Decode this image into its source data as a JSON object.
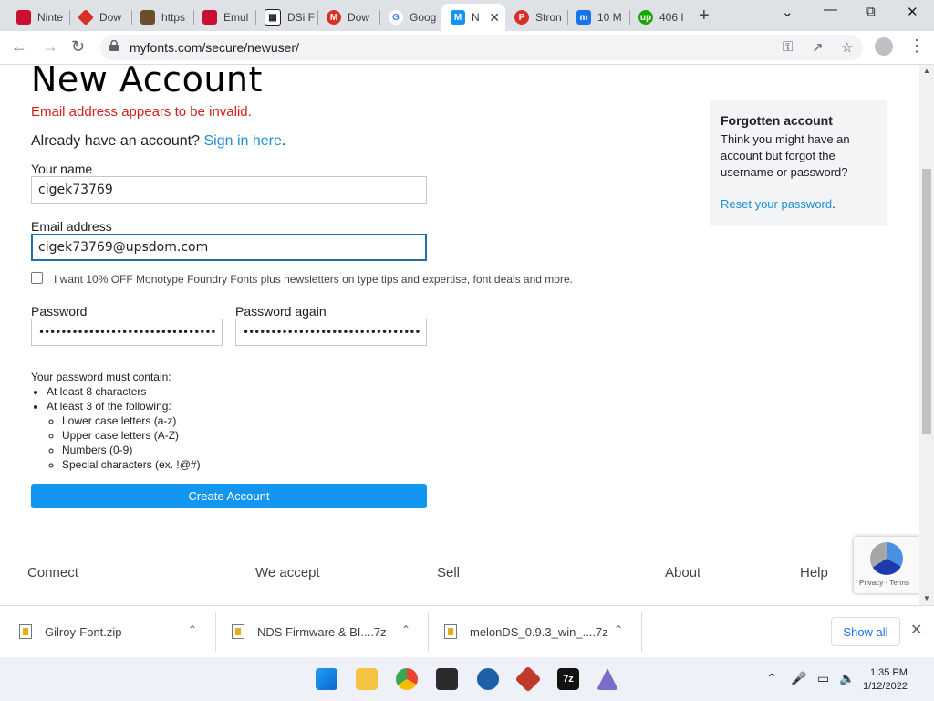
{
  "browser": {
    "tabs": [
      {
        "label": "Ninte",
        "icon": "nintendo-icon",
        "color": "#c8102e"
      },
      {
        "label": "Dow",
        "icon": "diamond-icon",
        "color": "#d93025"
      },
      {
        "label": "https",
        "icon": "cat-icon",
        "color": "#6b4f2a"
      },
      {
        "label": "Emul",
        "icon": "nintendo-icon",
        "color": "#c8102e"
      },
      {
        "label": "DSi F",
        "icon": "museum-icon",
        "color": "#202124"
      },
      {
        "label": "Dow",
        "icon": "mega-icon",
        "color": "#d93025"
      },
      {
        "label": "Goog",
        "icon": "google-icon",
        "color": "#4285f4"
      },
      {
        "label": "N",
        "icon": "myfonts-icon",
        "color": "#1296f0"
      },
      {
        "label": "Stron",
        "icon": "p-icon",
        "color": "#d93025"
      },
      {
        "label": "10 M",
        "icon": "m-icon",
        "color": "#1a73e8"
      },
      {
        "label": "406 I",
        "icon": "upwork-icon",
        "color": "#14a800"
      }
    ],
    "url": "myfonts.com/secure/newuser/"
  },
  "page": {
    "title": "New Account",
    "error": "Email address appears to be invalid.",
    "already_text": "Already have an account?",
    "signin_link": "Sign in here",
    "signin_suffix": ".",
    "name_label": "Your name",
    "name_value": "cigek73769",
    "email_label": "Email address",
    "email_value": "cigek73769@upsdom.com",
    "newsletter_label": "I want 10% OFF Monotype Foundry Fonts plus newsletters on type tips and expertise, font deals and more.",
    "password_label": "Password",
    "password_value": "••••••••••••••••••••••••••••••••",
    "password_again_label": "Password again",
    "password_again_value": "••••••••••••••••••••••••••••••••",
    "rules_heading": "Your password must contain:",
    "rule_1": "At least 8 characters",
    "rule_2": "At least 3 of the following:",
    "sub_rules": [
      "Lower case letters (a-z)",
      "Upper case letters (A-Z)",
      "Numbers (0-9)",
      "Special characters (ex. !@#)"
    ],
    "create_button": "Create Account"
  },
  "sidebar": {
    "title": "Forgotten account",
    "body": "Think you might have an account but forgot the username or password?",
    "link": "Reset your password",
    "link_suffix": "."
  },
  "footer": {
    "connect": "Connect",
    "we_accept": "We accept",
    "sell": "Sell",
    "about": "About",
    "help": "Help"
  },
  "recaptcha": {
    "text": "Privacy - Terms"
  },
  "downloads": {
    "items": [
      "Gilroy-Font.zip",
      "NDS Firmware & BI....7z",
      "melonDS_0.9.3_win_....7z"
    ],
    "show_all": "Show all"
  },
  "taskbar": {
    "time": "1:35 PM",
    "date": "1/12/2022"
  },
  "colors": {
    "accent": "#1296f0",
    "error": "#d0201b",
    "link": "#1a8fd6"
  }
}
